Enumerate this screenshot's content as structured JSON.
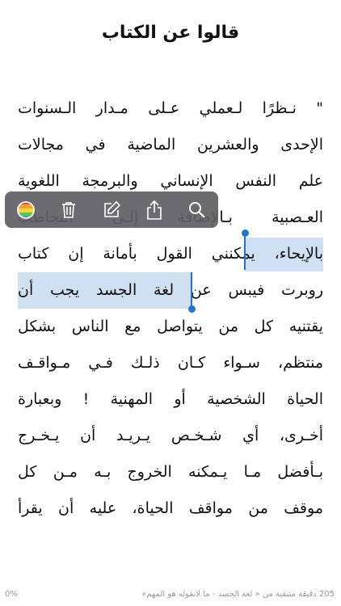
{
  "page": {
    "title": "قالوا عن الكتاب"
  },
  "text_lines": [
    "\" نـظرًا لـعملي عـلى مـدار الـسنوات",
    "الإحدى والعشرين الماضية في مجالات",
    "علم النفس الإنساني والبرمجة اللغوية",
    "العـصبية بـالإضافة إلـى التخاطب",
    [
      "بالإيحاء، ",
      "يمكنني القول بأمانة إن كتاب"
    ],
    [
      "روبرت فيبس عن لغة",
      " الجسد يجب أن"
    ],
    "يقتنيه كل من يتواصل مع الناس بشكل",
    "منتظم، سـواء كـان ذلـك فـي مـواقـف",
    "الحياة الشخصية أو المهنية ! وبعبارة",
    "أخـرى، أي شـخـص يـريـد أن يـخـرج",
    "بـأفضل مـا يـمكنه الخروج بـه مـن كل",
    "موقف من مواقف الحياة، عليه أن يقرأ"
  ],
  "toolbar": {
    "items": [
      {
        "icon": "color-picker-icon",
        "label": "color"
      },
      {
        "icon": "trash-icon",
        "label": "delete"
      },
      {
        "icon": "note-edit-icon",
        "label": "note"
      },
      {
        "icon": "share-icon",
        "label": "share"
      },
      {
        "icon": "search-icon",
        "label": "search"
      }
    ],
    "accent": "#1f74d8",
    "highlight": "#cfe0f3"
  },
  "footer": {
    "progress": "0%",
    "status": "205 دقيقة متبقية من « لغة الجسد - ما لانقوله هو المهم»"
  }
}
